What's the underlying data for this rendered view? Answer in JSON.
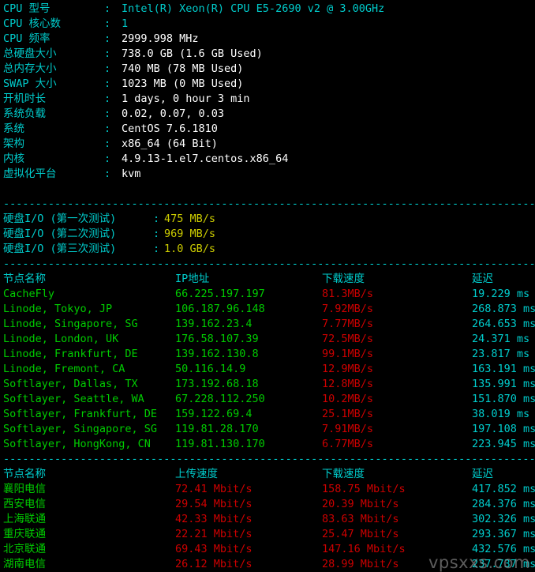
{
  "colors": {
    "background": "#000000",
    "label": "#00cccc",
    "value_white": "#ffffff",
    "value_cyan": "#00cccc",
    "value_yellow": "#cccc00",
    "value_green": "#00cc00",
    "value_red": "#cc0000",
    "value_magenta": "#cc00cc"
  },
  "separator": "--------------------------------------------------------------------------------------",
  "sysinfo": [
    {
      "label": "CPU 型号",
      "colon": ":",
      "value": "Intel(R) Xeon(R) CPU E5-2690 v2 @ 3.00GHz",
      "color": "cyan"
    },
    {
      "label": "CPU 核心数",
      "colon": ":",
      "value": "1",
      "color": "cyan"
    },
    {
      "label": "CPU 频率",
      "colon": ":",
      "value": "2999.998 MHz",
      "color": "white"
    },
    {
      "label": "总硬盘大小",
      "colon": ":",
      "value": "738.0 GB (1.6 GB Used)",
      "color": "white"
    },
    {
      "label": "总内存大小",
      "colon": ":",
      "value": "740 MB (78 MB Used)",
      "color": "white"
    },
    {
      "label": "SWAP 大小",
      "colon": ":",
      "value": "1023 MB (0 MB Used)",
      "color": "white"
    },
    {
      "label": "开机时长",
      "colon": ":",
      "value": "1 days, 0 hour 3 min",
      "color": "white"
    },
    {
      "label": "系统负载",
      "colon": ":",
      "value": "0.02, 0.07, 0.03",
      "color": "white"
    },
    {
      "label": "系统",
      "colon": ":",
      "value": "CentOS 7.6.1810",
      "color": "white"
    },
    {
      "label": "架构",
      "colon": ":",
      "value": "x86_64 (64 Bit)",
      "color": "white"
    },
    {
      "label": "内核",
      "colon": ":",
      "value": "4.9.13-1.el7.centos.x86_64",
      "color": "white"
    },
    {
      "label": "虚拟化平台",
      "colon": ":",
      "value": "kvm",
      "color": "white"
    }
  ],
  "diskio": [
    {
      "label": "硬盘I/O (第一次测试)",
      "colon": ":",
      "value": "475 MB/s",
      "color": "yellow"
    },
    {
      "label": "硬盘I/O (第二次测试)",
      "colon": ":",
      "value": "969 MB/s",
      "color": "yellow"
    },
    {
      "label": "硬盘I/O (第三次测试)",
      "colon": ":",
      "value": "1.0 GB/s",
      "color": "yellow"
    }
  ],
  "speedtest_intl": {
    "headers": [
      "节点名称",
      "IP地址",
      "下载速度",
      "延迟"
    ],
    "rows": [
      {
        "node": "CacheFly",
        "ip": "66.225.197.197",
        "speed": "81.3MB/s",
        "latency": "19.229 ms"
      },
      {
        "node": "Linode, Tokyo, JP",
        "ip": "106.187.96.148",
        "speed": "7.92MB/s",
        "latency": "268.873 ms"
      },
      {
        "node": "Linode, Singapore, SG",
        "ip": "139.162.23.4",
        "speed": "7.77MB/s",
        "latency": "264.653 ms"
      },
      {
        "node": "Linode, London, UK",
        "ip": "176.58.107.39",
        "speed": "72.5MB/s",
        "latency": "24.371 ms"
      },
      {
        "node": "Linode, Frankfurt, DE",
        "ip": "139.162.130.8",
        "speed": "99.1MB/s",
        "latency": "23.817 ms"
      },
      {
        "node": "Linode, Fremont, CA",
        "ip": "50.116.14.9",
        "speed": "12.9MB/s",
        "latency": "163.191 ms"
      },
      {
        "node": "Softlayer, Dallas, TX",
        "ip": "173.192.68.18",
        "speed": "12.8MB/s",
        "latency": "135.991 ms"
      },
      {
        "node": "Softlayer, Seattle, WA",
        "ip": "67.228.112.250",
        "speed": "10.2MB/s",
        "latency": "151.870 ms"
      },
      {
        "node": "Softlayer, Frankfurt, DE",
        "ip": "159.122.69.4",
        "speed": "25.1MB/s",
        "latency": "38.019 ms"
      },
      {
        "node": "Softlayer, Singapore, SG",
        "ip": "119.81.28.170",
        "speed": "7.91MB/s",
        "latency": "197.108 ms"
      },
      {
        "node": "Softlayer, HongKong, CN",
        "ip": "119.81.130.170",
        "speed": "6.77MB/s",
        "latency": "223.945 ms"
      }
    ]
  },
  "speedtest_cn": {
    "headers": [
      "节点名称",
      "上传速度",
      "下载速度",
      "延迟"
    ],
    "rows": [
      {
        "node": "襄阳电信",
        "upload": "72.41 Mbit/s",
        "download": "158.75 Mbit/s",
        "latency": "417.852 ms"
      },
      {
        "node": "西安电信",
        "upload": "29.54 Mbit/s",
        "download": "20.39 Mbit/s",
        "latency": "284.376 ms"
      },
      {
        "node": "上海联通",
        "upload": "42.33 Mbit/s",
        "download": "83.63 Mbit/s",
        "latency": "302.326 ms"
      },
      {
        "node": "重庆联通",
        "upload": "22.21 Mbit/s",
        "download": "25.47 Mbit/s",
        "latency": "293.367 ms"
      },
      {
        "node": "北京联通",
        "upload": "69.43 Mbit/s",
        "download": "147.16 Mbit/s",
        "latency": "432.576 ms"
      },
      {
        "node": "湖南电信",
        "upload": "26.12 Mbit/s",
        "download": "28.99 Mbit/s",
        "latency": "237.737 ms"
      }
    ]
  },
  "watermark": "vpsxxs.com"
}
